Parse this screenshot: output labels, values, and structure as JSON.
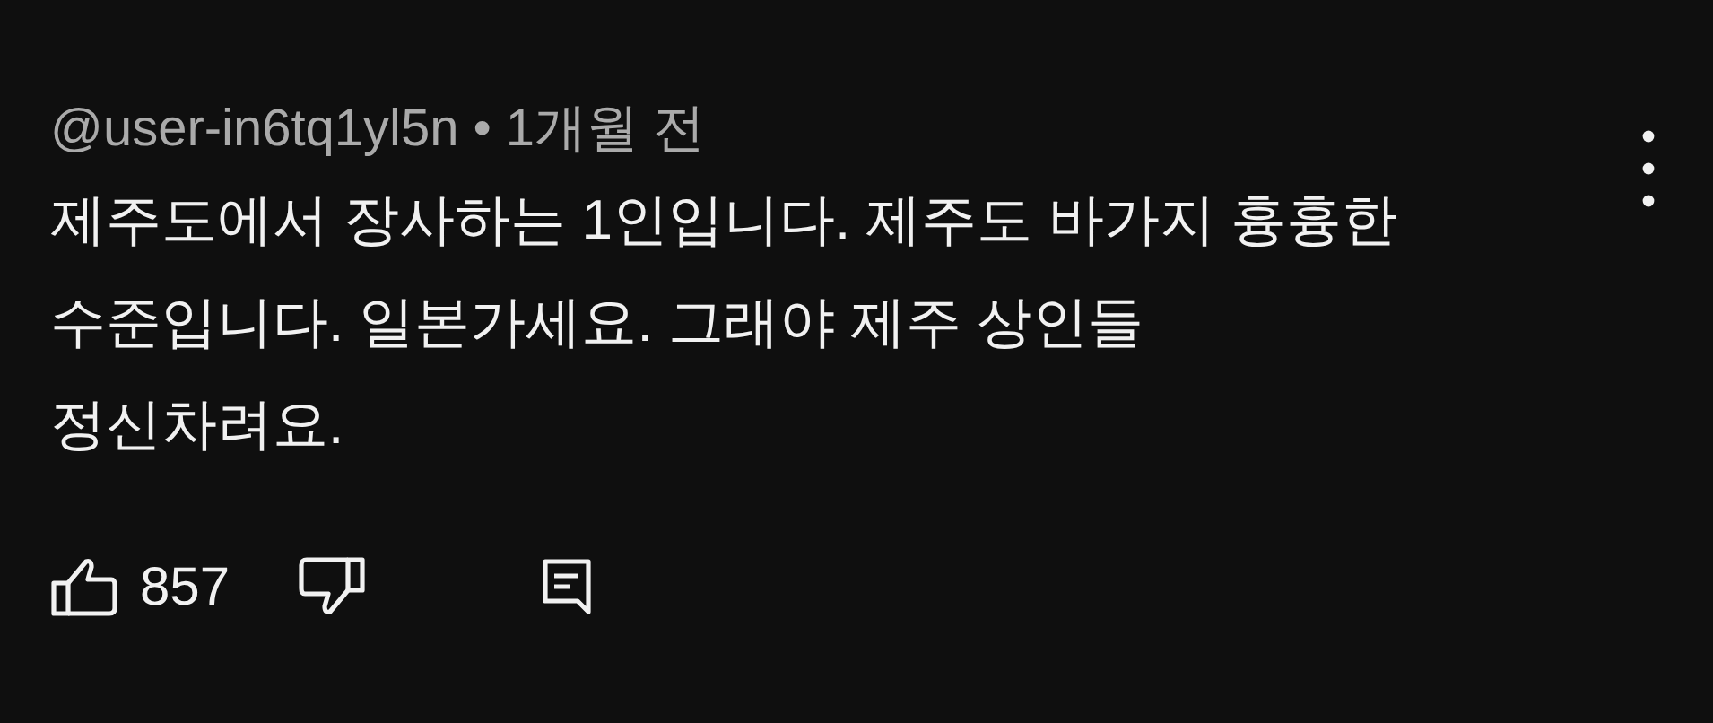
{
  "comment": {
    "author": "@user-in6tq1yl5n",
    "separator": "•",
    "time": "1개월 전",
    "text": "제주도에서 장사하는 1인입니다. 제주도 바가지 흉흉한\n수준입니다. 일본가세요. 그래야 제주 상인들\n정신차려요.",
    "likes": "857"
  }
}
